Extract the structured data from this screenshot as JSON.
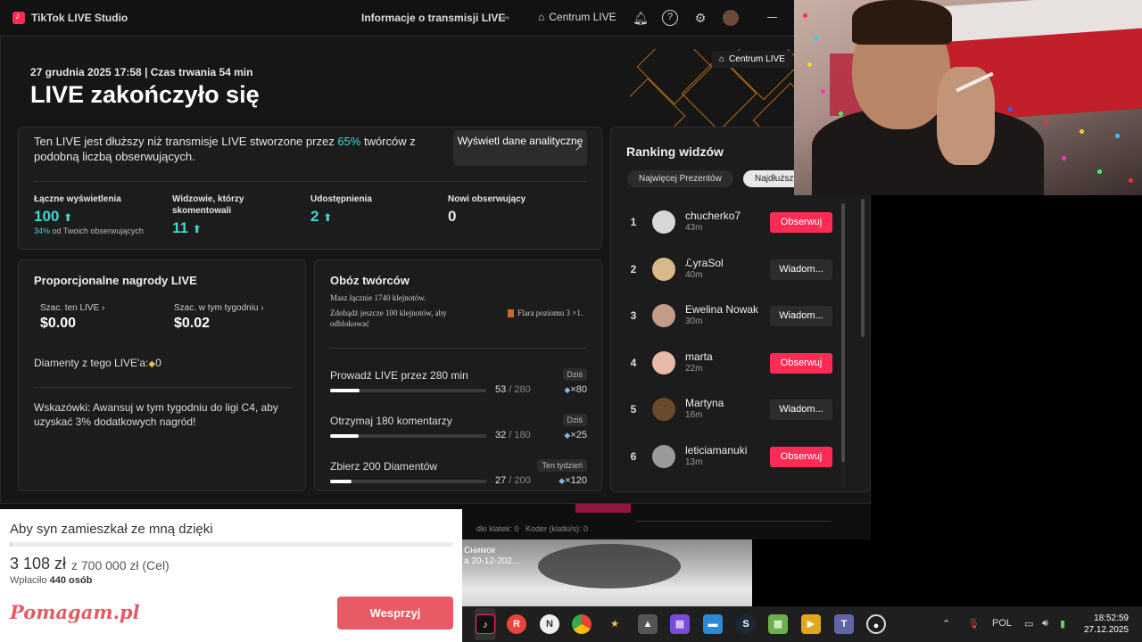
{
  "titlebar": {
    "app_title": "TikTok LIVE Studio",
    "info_link": "Informacje o transmisji LIVE",
    "center_link": "Centrum LIVE"
  },
  "summary": {
    "date_line": "27 grudnia 2025 17:58 | Czas trwania 54 min",
    "heading": "LIVE zakończyło się",
    "centrum_button": "Centrum LIVE"
  },
  "comparison": {
    "text_before": "Ten LIVE jest dłuższy niż transmisje LIVE stworzone przez ",
    "percent": "65%",
    "text_after": " twórców z podobną liczbą obserwujących.",
    "analytics_button": "Wyświetl dane analityczne",
    "stats": [
      {
        "label": "Łączne wyświetlenia",
        "value": "100",
        "trend": "up",
        "sub_pct": "34%",
        "sub_text": " od Twoich obserwujących"
      },
      {
        "label": "Widzowie, którzy skomentowali",
        "value": "11",
        "trend": "up"
      },
      {
        "label": "Udostępnienia",
        "value": "2",
        "trend": "up"
      },
      {
        "label": "Nowi obserwujący",
        "value": "0"
      }
    ]
  },
  "rewards": {
    "title": "Proporcjonalne nagrody LIVE",
    "est_live_label": "Szac. ten LIVE",
    "est_live_value": "$0.00",
    "est_week_label": "Szac. w tym tygodniu",
    "est_week_value": "$0.02",
    "diamonds_label": "Diamenty z tego LIVE'a:",
    "diamonds_value": "0",
    "tips": "Wskazówki: Awansuj w tym tygodniu do ligi C4, aby uzyskać 3% dodatkowych nagród!"
  },
  "camp": {
    "title": "Obóz twórców",
    "total_gems": "Masz łącznie 1740 klejnotów.",
    "unlock_text": "Zdobądź jeszcze 100 klejnotów, aby odblokować",
    "flare": "Flara poziomu 3 ×1.",
    "tasks": [
      {
        "name": "Prowadź LIVE przez 280 min",
        "badge": "Dziś",
        "current": "53",
        "total": "280",
        "progress": 0.19,
        "reward": "×80"
      },
      {
        "name": "Otrzymaj 180 komentarzy",
        "badge": "Dziś",
        "current": "32",
        "total": "180",
        "progress": 0.18,
        "reward": "×25"
      },
      {
        "name": "Zbierz 200 Diamentów",
        "badge": "Ten tydzień",
        "current": "27",
        "total": "200",
        "progress": 0.135,
        "reward": "×120"
      }
    ]
  },
  "ranking": {
    "title": "Ranking widzów",
    "tab_gifts": "Najwięcej Prezentów",
    "tab_longest": "Najdłuższy",
    "viewers": [
      {
        "rank": "1",
        "name": "chucherko7",
        "time": "43m",
        "action": "Obserwuj",
        "kind": "follow",
        "avatar_color": "#d8d8d8"
      },
      {
        "rank": "2",
        "name": "ℒyraSol",
        "time": "40m",
        "action": "Wiadom...",
        "kind": "msg",
        "avatar_color": "#d9b98a"
      },
      {
        "rank": "3",
        "name": "Ewelina Nowak",
        "time": "30m",
        "action": "Wiadom...",
        "kind": "msg",
        "avatar_color": "#c49a88"
      },
      {
        "rank": "4",
        "name": "marta",
        "time": "22m",
        "action": "Obserwuj",
        "kind": "follow",
        "avatar_color": "#e8b9a8"
      },
      {
        "rank": "5",
        "name": "Martyna",
        "time": "16m",
        "action": "Wiadom...",
        "kind": "msg",
        "avatar_color": "#6b4a2a"
      },
      {
        "rank": "6",
        "name": "leticiamanuki",
        "time": "13m",
        "action": "Obserwuj",
        "kind": "follow",
        "avatar_color": "#9a9a9a"
      }
    ]
  },
  "background_app": {
    "frames_label": "dki klatek: 0",
    "encoder_label": "Koder (klatki/s): 0"
  },
  "donation": {
    "title": "Aby syn zamieszkał ze mną dzięki",
    "raised": "3 108 zł",
    "goal": "z 700 000 zł (Cel)",
    "people_prefix": "Wpłaciło ",
    "people_count": "440 osób",
    "progress": 0.0044,
    "brand": "Pomagam.pl",
    "button": "Wesprzyj"
  },
  "video": {
    "label_line1": "Снимок",
    "label_line2": "а 20-12-202..."
  },
  "taskbar": {
    "language": "POL",
    "time": "18:52:59",
    "date": "27.12.2025"
  }
}
